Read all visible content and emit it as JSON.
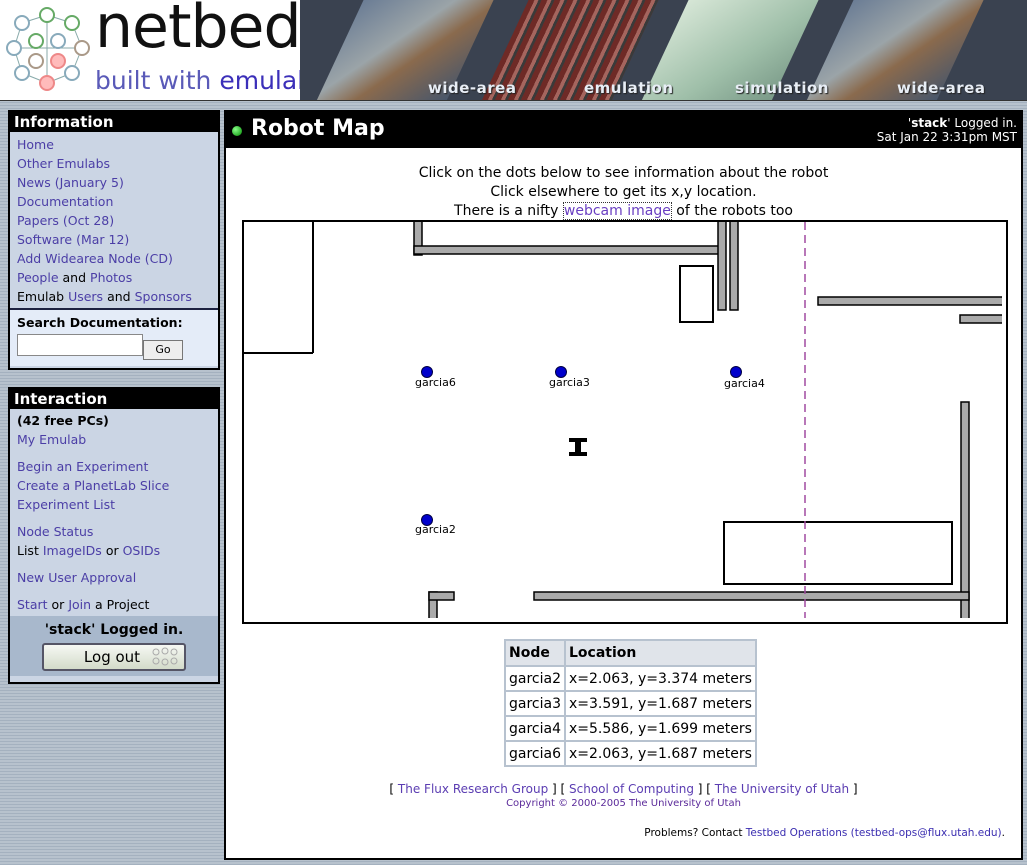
{
  "banner": {
    "logo_word": "netbed",
    "logo_sub_prefix": "built with ",
    "logo_sub_brand": "emulab",
    "captions": [
      "wide-area",
      "emulation",
      "simulation",
      "wide-area"
    ]
  },
  "info_box": {
    "title": "Information",
    "items": [
      {
        "label": "Home"
      },
      {
        "label": "Other Emulabs"
      },
      {
        "label": "News (January 5)"
      },
      {
        "label": "Documentation"
      },
      {
        "label": "Papers (Oct 28)"
      },
      {
        "label": "Software (Mar 12)"
      },
      {
        "label": "Add Widearea Node (CD)"
      }
    ],
    "people_label": "People",
    "and_label": "and",
    "photos_label": "Photos",
    "emulab_label": "Emulab",
    "users_label": "Users",
    "and2_label": "and",
    "sponsors_label": "Sponsors",
    "search_label": "Search Documentation:",
    "search_value": "",
    "go_label": "Go"
  },
  "interaction_box": {
    "title": "Interaction",
    "free_pcs": "(42 free PCs)",
    "my_emulab": "My Emulab",
    "begin_experiment": "Begin an Experiment",
    "planetlab_slice": "Create a PlanetLab Slice",
    "experiment_list": "Experiment List",
    "node_status": "Node Status",
    "list_label": "List",
    "imageids": "ImageIDs",
    "or_label": "or",
    "osids": "OSIDs",
    "new_user_approval": "New User Approval",
    "start": "Start",
    "or2_label": "or",
    "join": "Join",
    "a_project": "a Project",
    "logged_in": "'stack' Logged in.",
    "logout_label": "Log out"
  },
  "header": {
    "title": "Robot Map",
    "user": "stack",
    "logged_suffix": "' Logged in.",
    "datetime": "Sat Jan 22 3:31pm MST"
  },
  "instructions": {
    "line1": "Click on the dots below to see information about the robot",
    "line2": "Click elsewhere to get its x,y location.",
    "line3_prefix": "There is a nifty ",
    "webcam_link": "webcam image",
    "line3_suffix": " of the robots too"
  },
  "robots": [
    "garcia6",
    "garcia3",
    "garcia4",
    "garcia2"
  ],
  "location_table": {
    "headers": [
      "Node",
      "Location"
    ],
    "rows": [
      [
        "garcia2",
        "x=2.063, y=3.374 meters"
      ],
      [
        "garcia3",
        "x=3.591, y=1.687 meters"
      ],
      [
        "garcia4",
        "x=5.586, y=1.699 meters"
      ],
      [
        "garcia6",
        "x=2.063, y=1.687 meters"
      ]
    ]
  },
  "footer": {
    "flux": "The Flux Research Group",
    "soc": "School of Computing",
    "uofu": "The University of Utah",
    "copyright": "Copyright © 2000-2005 The University of Utah",
    "problems_prefix": "Problems? Contact ",
    "ops_link": "Testbed Operations (testbed-ops@flux.utah.edu)",
    "problems_suffix": "."
  },
  "colors": {
    "robot_dot": "#0000cc",
    "link": "#3a2db0",
    "sidebar_bg": "#cbd5e4"
  }
}
